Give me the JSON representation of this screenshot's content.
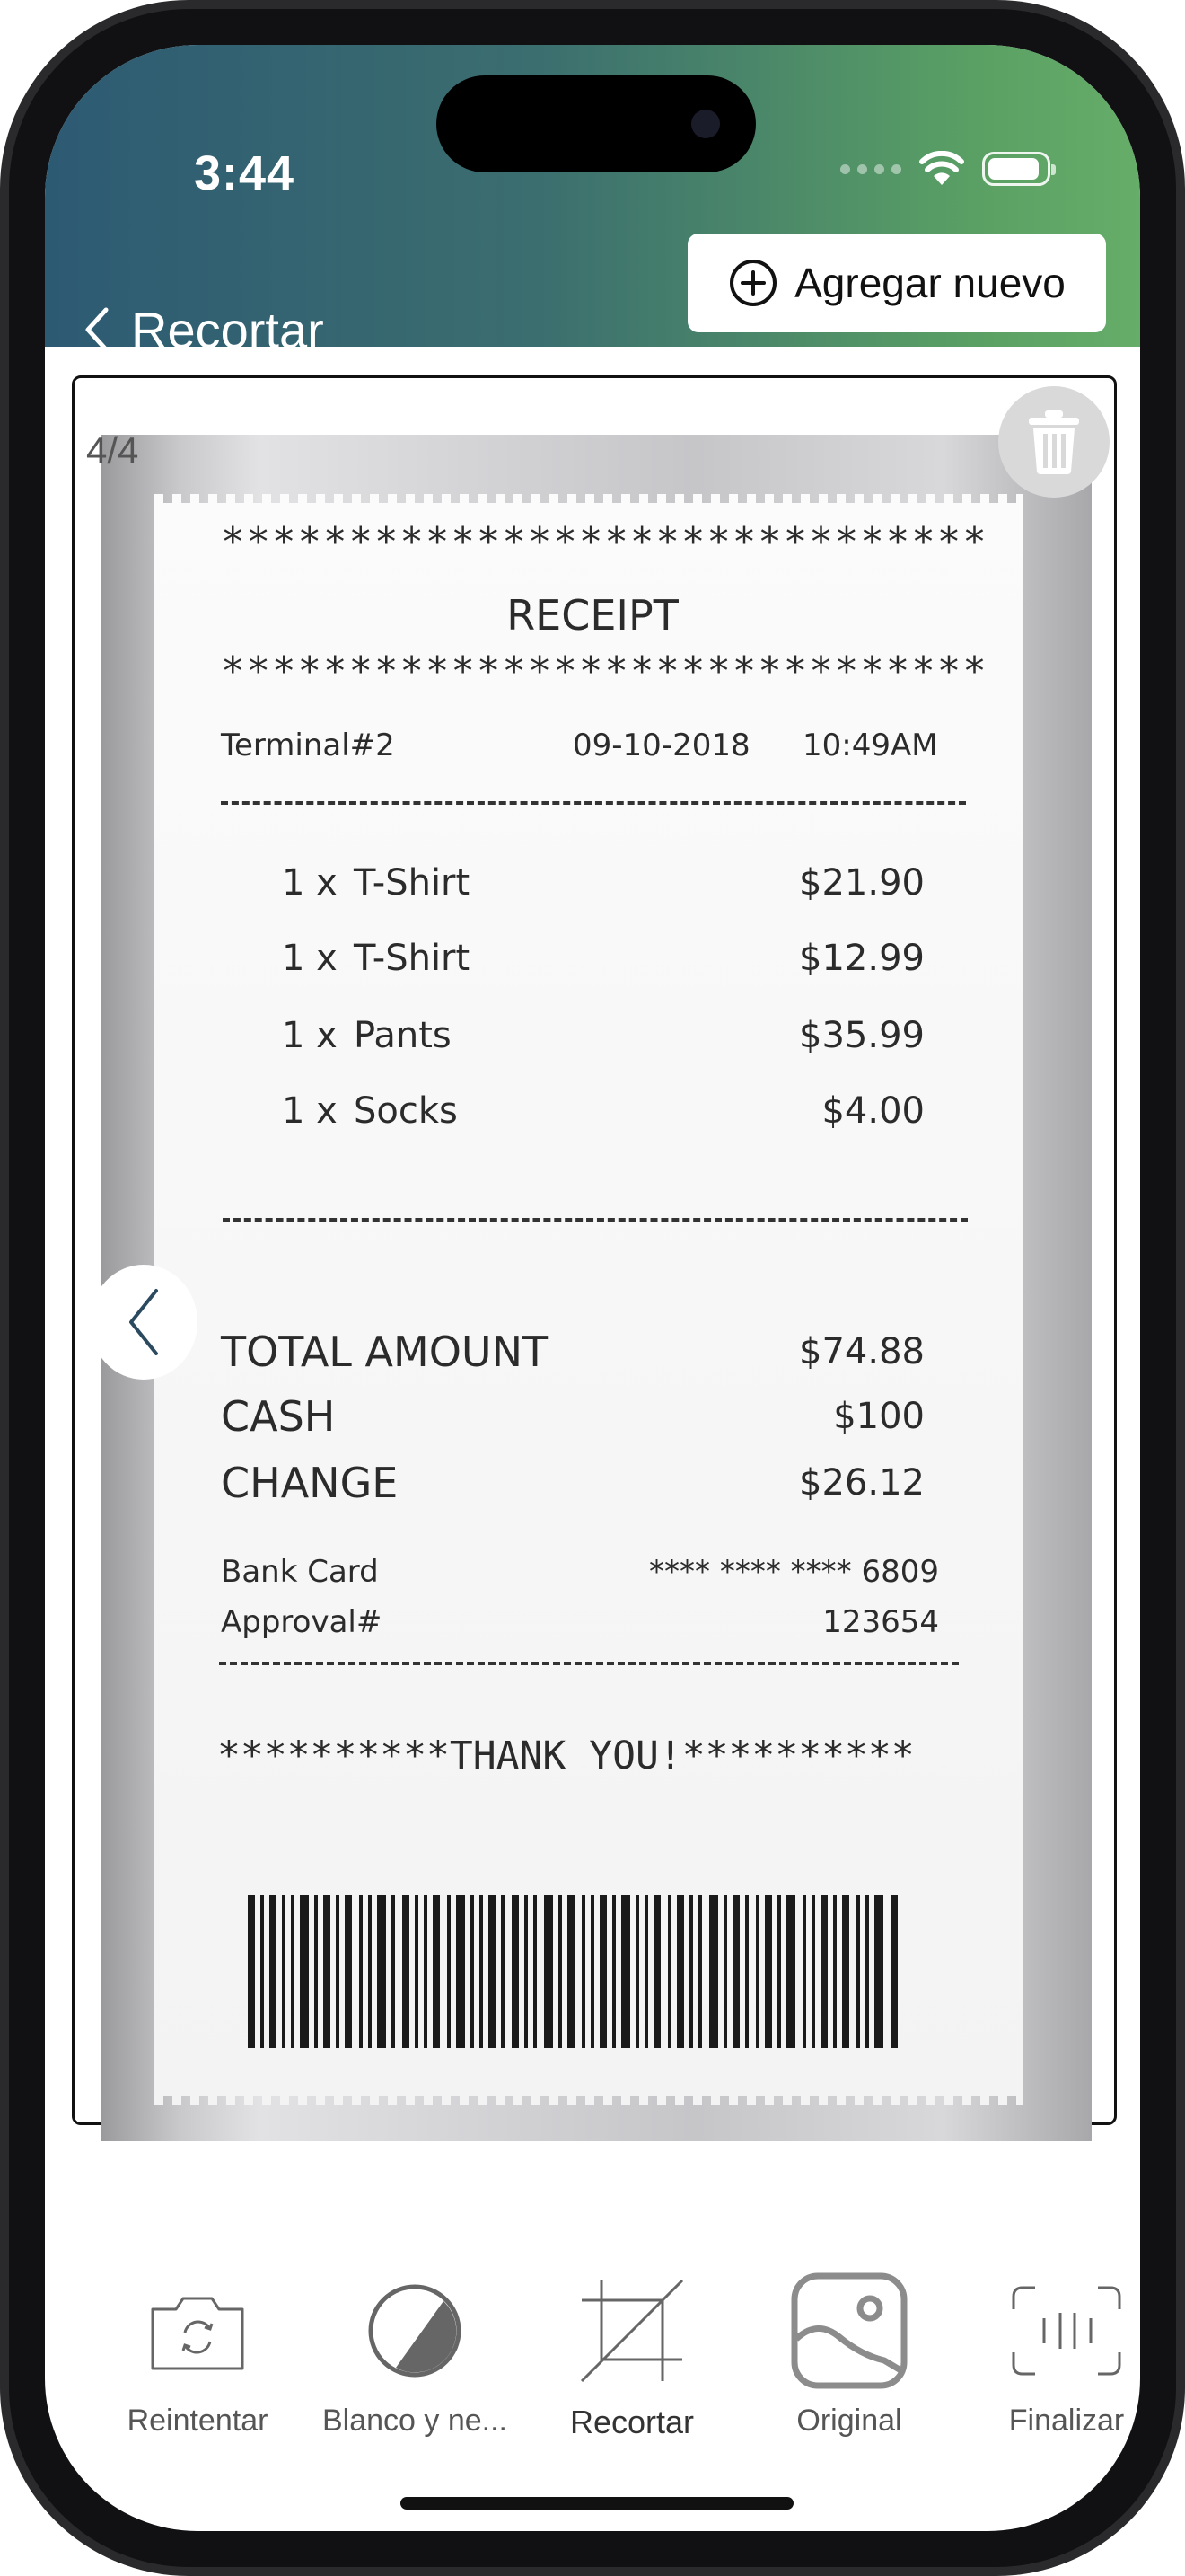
{
  "status_bar": {
    "time": "3:44"
  },
  "header": {
    "title": "Recortar",
    "add_button_label": "Agregar nuevo"
  },
  "viewer": {
    "page_counter": "4/4"
  },
  "receipt": {
    "stars_line": "******************************",
    "title": "RECEIPT",
    "terminal": "Terminal#2",
    "date": "09-10-2018",
    "time": "10:49AM",
    "items": [
      {
        "qty": "1 x",
        "name": "T-Shirt",
        "price": "$21.90"
      },
      {
        "qty": "1 x",
        "name": "T-Shirt",
        "price": "$12.99"
      },
      {
        "qty": "1 x",
        "name": "Pants",
        "price": "$35.99"
      },
      {
        "qty": "1 x",
        "name": "Socks",
        "price": "$4.00"
      }
    ],
    "totals": [
      {
        "label": "TOTAL AMOUNT",
        "value": "$74.88"
      },
      {
        "label": "CASH",
        "value": "$100"
      },
      {
        "label": "CHANGE",
        "value": "$26.12"
      }
    ],
    "bank_card_label": "Bank Card",
    "bank_card_value": "**** **** **** 6809",
    "approval_label": "Approval#",
    "approval_value": "123654",
    "thank_you": "**********THANK YOU!**********"
  },
  "toolbar": {
    "items": [
      {
        "label": "Reintentar",
        "icon": "camera-rotate-icon"
      },
      {
        "label": "Blanco y ne...",
        "icon": "contrast-icon"
      },
      {
        "label": "Recortar",
        "icon": "crop-icon"
      },
      {
        "label": "Original",
        "icon": "image-icon"
      },
      {
        "label": "Finalizar",
        "icon": "scan-icon"
      }
    ]
  }
}
